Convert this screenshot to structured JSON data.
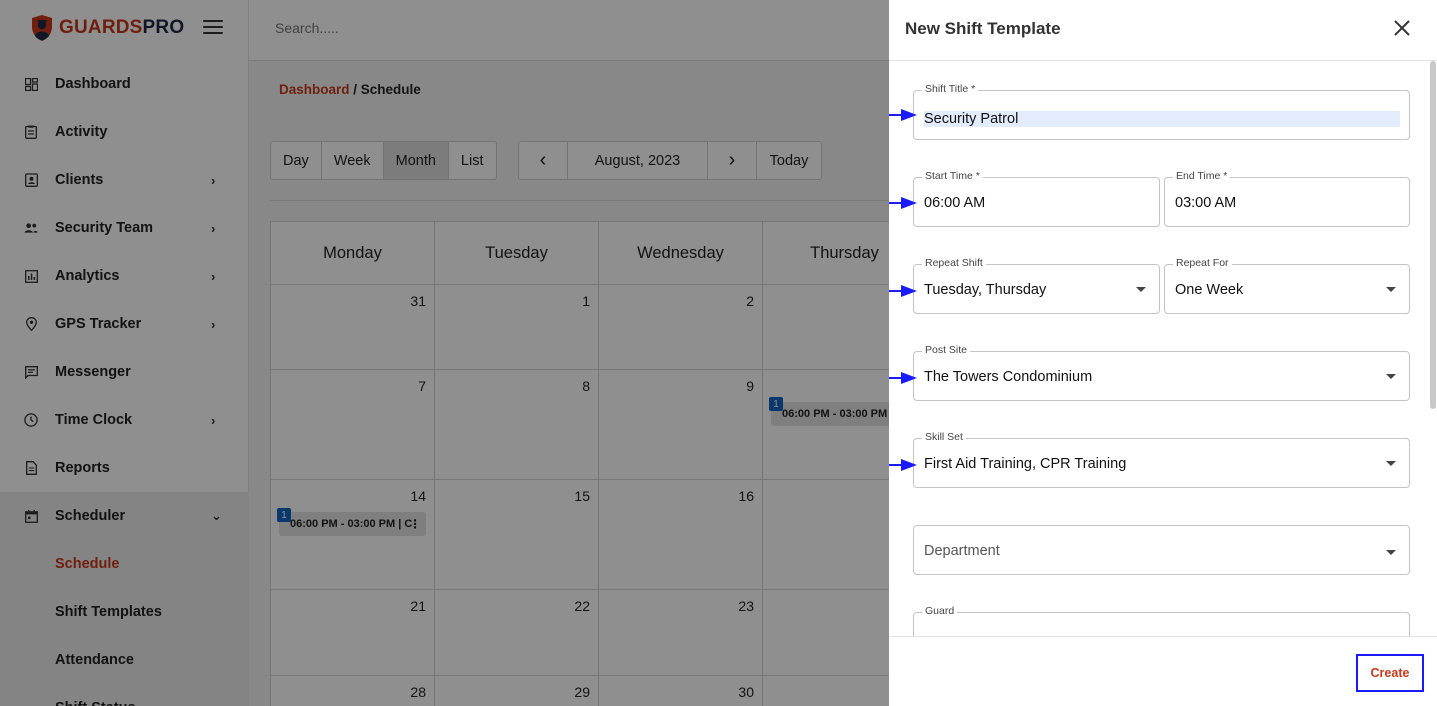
{
  "app": {
    "name_part1": "GUARDS",
    "name_part2": "PRO"
  },
  "colors": {
    "brand_red": "#c8381c",
    "brand_navy": "#1f2a44",
    "event_badge": "#1565c0",
    "annotation_blue": "#1a1aff"
  },
  "sidebar": {
    "items": [
      {
        "label": "Dashboard",
        "icon": "dashboard-icon",
        "chevron": ""
      },
      {
        "label": "Activity",
        "icon": "clipboard-icon",
        "chevron": ""
      },
      {
        "label": "Clients",
        "icon": "contact-icon",
        "chevron": "›"
      },
      {
        "label": "Security Team",
        "icon": "people-icon",
        "chevron": "›"
      },
      {
        "label": "Analytics",
        "icon": "bar-chart-icon",
        "chevron": "›"
      },
      {
        "label": "GPS Tracker",
        "icon": "location-pin-icon",
        "chevron": "›"
      },
      {
        "label": "Messenger",
        "icon": "message-icon",
        "chevron": ""
      },
      {
        "label": "Time Clock",
        "icon": "clock-icon",
        "chevron": "›"
      },
      {
        "label": "Reports",
        "icon": "document-icon",
        "chevron": ""
      },
      {
        "label": "Scheduler",
        "icon": "calendar-icon",
        "chevron": "⌄"
      }
    ],
    "sub_items": [
      "Schedule",
      "Shift Templates",
      "Attendance",
      "Shift Status"
    ]
  },
  "search": {
    "placeholder": "Search....."
  },
  "breadcrumb": {
    "link": "Dashboard",
    "separator": " / ",
    "current": "Schedule"
  },
  "calendar": {
    "views": [
      "Day",
      "Week",
      "Month",
      "List"
    ],
    "selected_view": "Month",
    "prev": "‹",
    "next": "›",
    "month_label": "August, 2023",
    "today": "Today",
    "weekdays": [
      "Monday",
      "Tuesday",
      "Wednesday",
      "Thursday"
    ],
    "weeks": [
      [
        "31",
        "1",
        "2",
        ""
      ],
      [
        "7",
        "8",
        "9",
        ""
      ],
      [
        "14",
        "15",
        "16",
        ""
      ],
      [
        "21",
        "22",
        "23",
        ""
      ],
      [
        "28",
        "29",
        "30",
        ""
      ]
    ],
    "events": [
      {
        "badge": "1",
        "text": "06:00 PM - 03:00 PM"
      },
      {
        "badge": "1",
        "text": "06:00 PM - 03:00 PM | C"
      }
    ]
  },
  "drawer": {
    "title": "New Shift Template",
    "fields": {
      "shift_title": {
        "label": "Shift Title *",
        "value": "Security Patrol"
      },
      "start_time": {
        "label": "Start Time *",
        "value": "06:00 AM"
      },
      "end_time": {
        "label": "End Time *",
        "value": "03:00 AM"
      },
      "repeat_shift": {
        "label": "Repeat Shift",
        "value": "Tuesday, Thursday"
      },
      "repeat_for": {
        "label": "Repeat For",
        "value": "One Week"
      },
      "post_site": {
        "label": "Post Site",
        "value": "The Towers Condominium"
      },
      "skill_set": {
        "label": "Skill Set",
        "value": "First Aid Training, CPR Training"
      },
      "department": {
        "placeholder": "Department"
      },
      "guard": {
        "label": "Guard"
      }
    },
    "create_label": "Create"
  }
}
